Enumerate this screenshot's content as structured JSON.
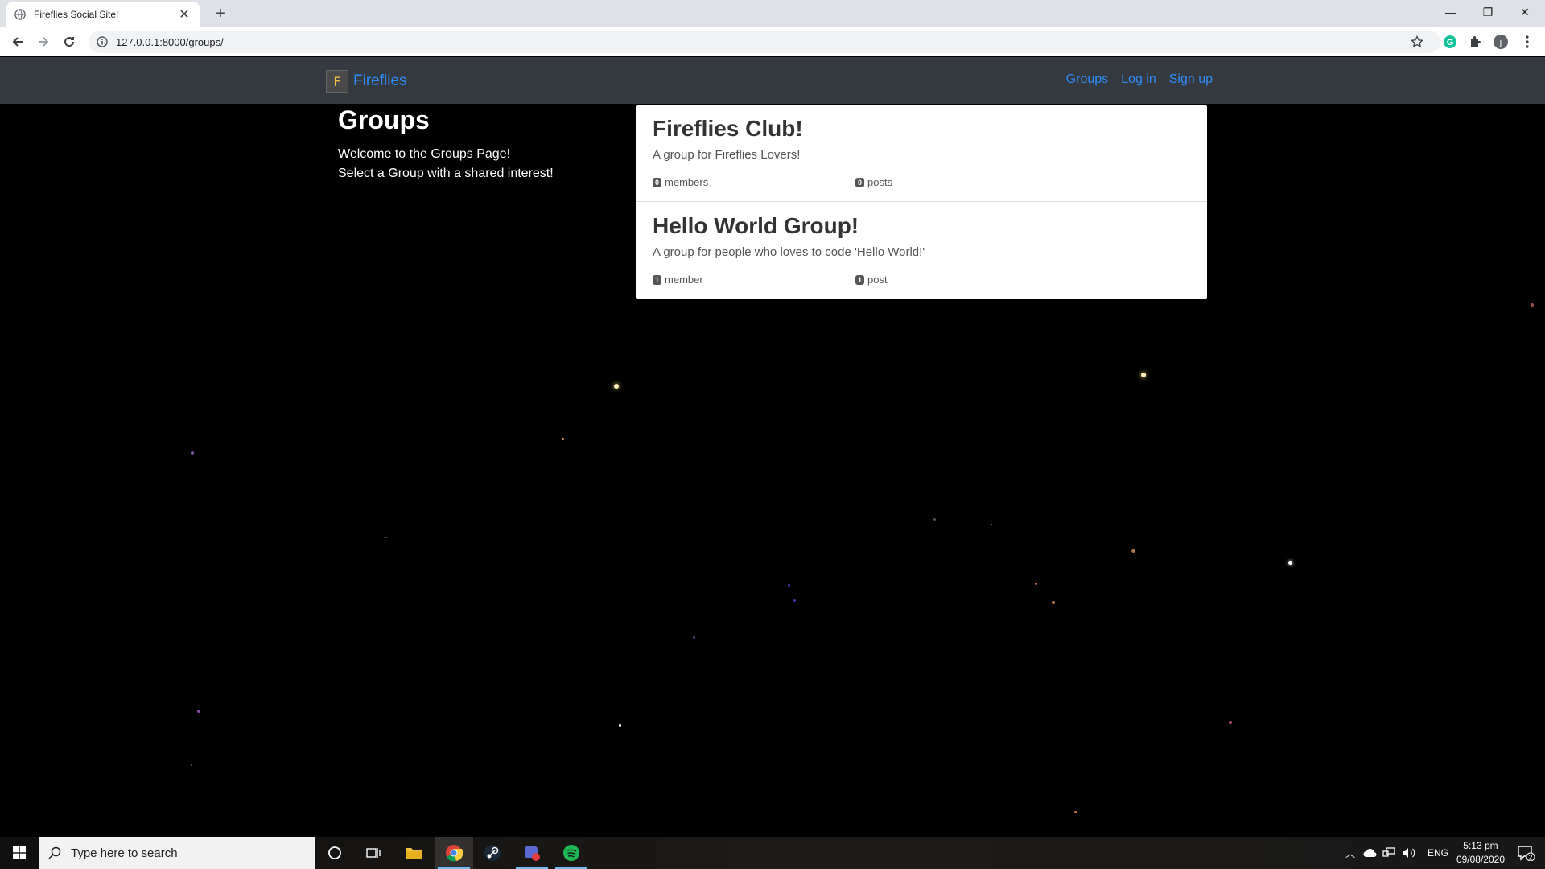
{
  "browser": {
    "tab_title": "Fireflies Social Site!",
    "url": "127.0.0.1:8000/groups/",
    "profile_initial": "j"
  },
  "site": {
    "brand_logo": "F",
    "brand_name": "Fireflies",
    "nav": [
      {
        "label": "Groups"
      },
      {
        "label": "Log in"
      },
      {
        "label": "Sign up"
      }
    ],
    "link_color": "#2f8cf7",
    "navbar_color": "#343a40"
  },
  "intro": {
    "heading": "Groups",
    "line1": "Welcome to the Groups Page!",
    "line2": "Select a Group with a shared interest!"
  },
  "groups": [
    {
      "name": "Fireflies Club!",
      "description": "A group for Fireflies Lovers!",
      "members_count": "0",
      "members_label": "members",
      "posts_count": "0",
      "posts_label": "posts"
    },
    {
      "name": "Hello World Group!",
      "description": "A group for people who loves to code 'Hello World!'",
      "members_count": "1",
      "members_label": "member",
      "posts_count": "1",
      "posts_label": "post"
    }
  ],
  "taskbar": {
    "search_placeholder": "Type here to search",
    "language": "ENG",
    "time": "5:13 pm",
    "date": "09/08/2020",
    "notification_count": "2"
  }
}
